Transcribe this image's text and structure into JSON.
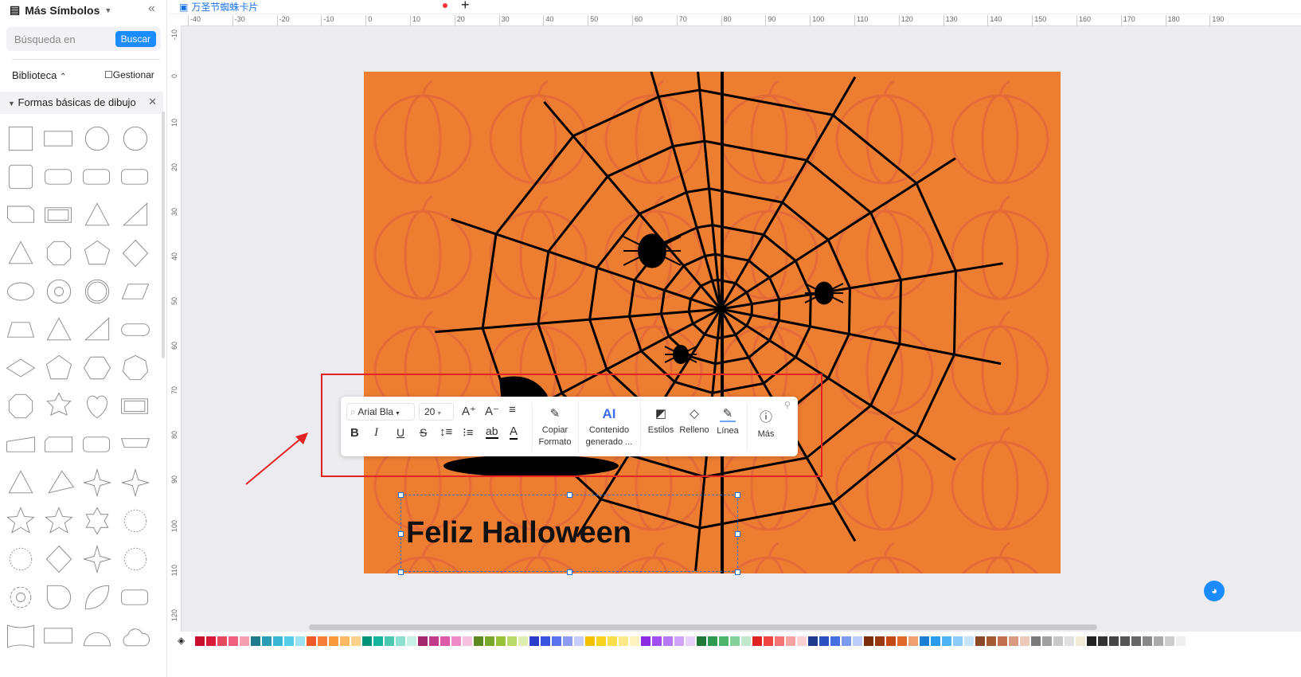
{
  "sidebar": {
    "title": "Más Símbolos",
    "search_placeholder": "Búsqueda en",
    "search_button": "Buscar",
    "library_label": "Biblioteca",
    "manage_label": "Gestionar",
    "category": "Formas básicas de dibujo",
    "shapes": [
      "square",
      "rect",
      "circle",
      "circle",
      "rounded-square",
      "rounded-rect",
      "rounded-rect",
      "rounded-rect",
      "tag",
      "frame",
      "triangle",
      "right-tri",
      "triangle",
      "octagon",
      "pentagon",
      "diamond",
      "ellipse",
      "ring",
      "ring2",
      "parallelogram",
      "trapezoid",
      "triangle",
      "right-tri",
      "pill",
      "diamond-wide",
      "pentagon",
      "hexagon",
      "heptagon",
      "octagon",
      "star-blob",
      "heart",
      "frame",
      "slope",
      "cut-rect",
      "rounded-rect",
      "banner",
      "triangle",
      "kite",
      "star4",
      "star4",
      "star5",
      "star5",
      "star6",
      "burst",
      "burst",
      "diamond",
      "star4",
      "burst",
      "gear",
      "drop",
      "leaf",
      "rounded-rect",
      "wave",
      "rect",
      "half-circle",
      "cloud"
    ]
  },
  "tabs": [
    {
      "label": "万圣节蜘蛛卡片"
    }
  ],
  "ruler": {
    "top": [
      "-40",
      "-30",
      "-20",
      "-10",
      "0",
      "10",
      "20",
      "30",
      "40",
      "50",
      "60",
      "70",
      "80",
      "90",
      "100",
      "110",
      "120",
      "130",
      "140",
      "150",
      "160",
      "170",
      "180",
      "190"
    ],
    "left": [
      "-10",
      "0",
      "10",
      "20",
      "30",
      "40",
      "50",
      "60",
      "70",
      "80",
      "90",
      "100",
      "110",
      "120"
    ]
  },
  "canvas": {
    "text": "Feliz Halloween",
    "background": "#ed7d31"
  },
  "toolbar": {
    "font": "Arial Bla",
    "size": "20",
    "copy_format": [
      "Copiar",
      "Formato"
    ],
    "ai_label": "AI",
    "ai_content": [
      "Contenido",
      "generado ..."
    ],
    "styles": "Estilos",
    "fill": "Relleno",
    "line": "Línea",
    "more": "Más"
  },
  "palette": [
    "#c8102e",
    "#d81b3a",
    "#e84a5f",
    "#f06080",
    "#f4a0b0",
    "#1f7a8c",
    "#2a9db5",
    "#3bb6d4",
    "#55cde8",
    "#9be3f2",
    "#f05a28",
    "#f77f3a",
    "#fb9a3c",
    "#fdb863",
    "#ffd08a",
    "#00937a",
    "#14b39b",
    "#4bc9b0",
    "#8be0cf",
    "#c9f0e7",
    "#a3286b",
    "#c23c8c",
    "#dc5aa8",
    "#ee8ac8",
    "#f7c1e0",
    "#5c8a1e",
    "#7aa82a",
    "#98c23a",
    "#b9d96b",
    "#dcefb1",
    "#2a3cc9",
    "#3a55e0",
    "#5a74ef",
    "#8e9cf5",
    "#c5cdfa",
    "#f2c200",
    "#f7d21f",
    "#fadf4a",
    "#fce985",
    "#fef3c0",
    "#8a2be2",
    "#a14df0",
    "#b778f5",
    "#cfa3f8",
    "#e7d1fb",
    "#1f7a3a",
    "#2e9a4f",
    "#4db46c",
    "#85cf9a",
    "#c2e8cb",
    "#e02424",
    "#ef4444",
    "#f47373",
    "#f8a3a3",
    "#fcd1d1",
    "#1e3a8a",
    "#2b50c0",
    "#4670e0",
    "#7c9bf0",
    "#bccbf7",
    "#7a2e0e",
    "#9a3a10",
    "#c24a12",
    "#e06a2a",
    "#f0a070",
    "#1c7fd6",
    "#2a9bef",
    "#50b3f5",
    "#8ccbf8",
    "#c6e5fb",
    "#8a4a2a",
    "#a55a36",
    "#c07050",
    "#d89a80",
    "#ecc9b8",
    "#7a7a7a",
    "#a0a0a0",
    "#c8c8c8",
    "#e0e0e0",
    "#f0ead6",
    "#222222",
    "#333333",
    "#444444",
    "#555555",
    "#666666",
    "#888888",
    "#aaaaaa",
    "#cccccc",
    "#eeeeee",
    "#ffffff"
  ]
}
